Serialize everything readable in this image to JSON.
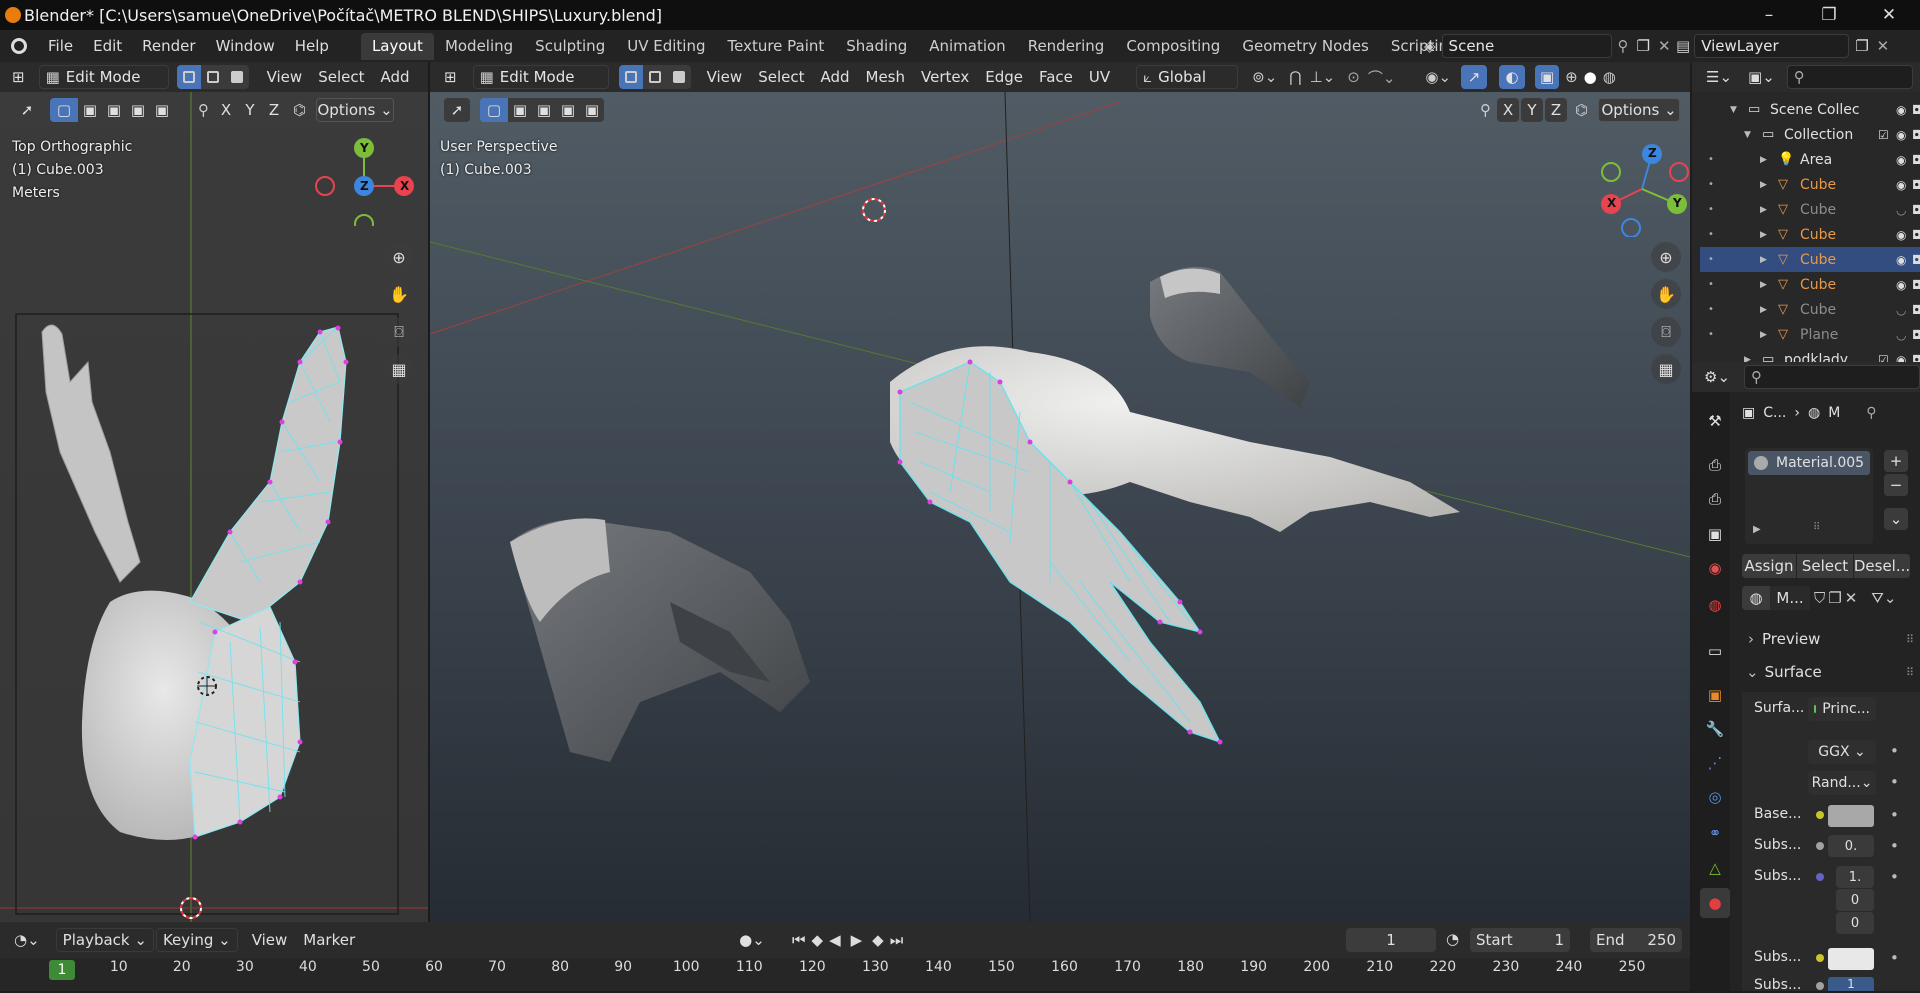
{
  "window": {
    "title": "Blender* [C:\\Users\\samue\\OneDrive\\Počítač\\METRO BLEND\\SHIPS\\Luxury.blend]",
    "minimize": "–",
    "maximize": "❐",
    "close": "✕"
  },
  "menu": [
    "File",
    "Edit",
    "Render",
    "Window",
    "Help"
  ],
  "workspaces": [
    "Layout",
    "Modeling",
    "Sculpting",
    "UV Editing",
    "Texture Paint",
    "Shading",
    "Animation",
    "Rendering",
    "Compositing",
    "Geometry Nodes",
    "Scripting",
    "+"
  ],
  "active_workspace": "Layout",
  "scene": {
    "label": "Scene",
    "view_layer": "ViewLayer"
  },
  "left_view": {
    "mode": "Edit Mode",
    "menus": [
      "View",
      "Select",
      "Add"
    ],
    "axes": [
      "X",
      "Y",
      "Z"
    ],
    "options": "Options",
    "info": [
      "Top Orthographic",
      "(1) Cube.003",
      "Meters"
    ],
    "gizmo": {
      "y": "Y",
      "z": "Z",
      "x": "X"
    }
  },
  "main_view": {
    "mode": "Edit Mode",
    "menus": [
      "View",
      "Select",
      "Add",
      "Mesh",
      "Vertex",
      "Edge",
      "Face",
      "UV"
    ],
    "orientation": "Global",
    "axes": [
      "X",
      "Y",
      "Z"
    ],
    "options": "Options",
    "info": [
      "User Perspective",
      "(1) Cube.003"
    ],
    "gizmo": {
      "z": "Z",
      "x": "X",
      "y": "Y"
    }
  },
  "outliner": {
    "search_placeholder": "",
    "rows": [
      {
        "label": "Scene Collec",
        "indent": 0,
        "type": "collection"
      },
      {
        "label": "Collection",
        "indent": 1,
        "type": "collection"
      },
      {
        "label": "Area",
        "indent": 2,
        "type": "light"
      },
      {
        "label": "Cube",
        "indent": 2,
        "type": "mesh"
      },
      {
        "label": "Cube",
        "indent": 2,
        "type": "mesh",
        "hidden": true
      },
      {
        "label": "Cube",
        "indent": 2,
        "type": "mesh"
      },
      {
        "label": "Cube",
        "indent": 2,
        "type": "mesh",
        "selected": true
      },
      {
        "label": "Cube",
        "indent": 2,
        "type": "mesh"
      },
      {
        "label": "Cube",
        "indent": 2,
        "type": "mesh",
        "hidden": true
      },
      {
        "label": "Plane",
        "indent": 2,
        "type": "mesh",
        "hidden": true
      },
      {
        "label": "podklady",
        "indent": 1,
        "type": "collection"
      }
    ]
  },
  "properties": {
    "breadcrumb": [
      "C...",
      "M"
    ],
    "material_slot": "Material.005",
    "assign": "Assign",
    "select": "Select",
    "deselect": "Desel...",
    "material_name": "M...",
    "preview": "Preview",
    "surface_header": "Surface",
    "surface_label": "Surfa...",
    "surface_value": "Princ...",
    "distribution": "GGX",
    "subsurface_method": "Rand...",
    "base_label": "Base...",
    "subs1_label": "Subs...",
    "subs1_value": "0.",
    "subs2_label": "Subs...",
    "subs2_values": [
      "1.",
      "0",
      "0"
    ],
    "subs3_label": "Subs...",
    "subs4_label": "Subs...",
    "subs4_value": "1"
  },
  "timeline": {
    "menus": [
      "Playback",
      "Keying",
      "View",
      "Marker"
    ],
    "current_frame": "1",
    "start_label": "Start",
    "start": "1",
    "end_label": "End",
    "end": "250",
    "ruler_current": "1",
    "ticks": [
      "10",
      "20",
      "30",
      "40",
      "50",
      "60",
      "70",
      "80",
      "90",
      "100",
      "110",
      "120",
      "130",
      "140",
      "150",
      "160",
      "170",
      "180",
      "190",
      "200",
      "210",
      "220",
      "230",
      "240",
      "250"
    ]
  },
  "colors": {
    "accent": "#4a74b8",
    "selection": "#e98a2a",
    "x_axis": "#e8444f",
    "y_axis": "#7cbe3a",
    "z_axis": "#3d86e0",
    "wire": "#5fe6f0"
  }
}
